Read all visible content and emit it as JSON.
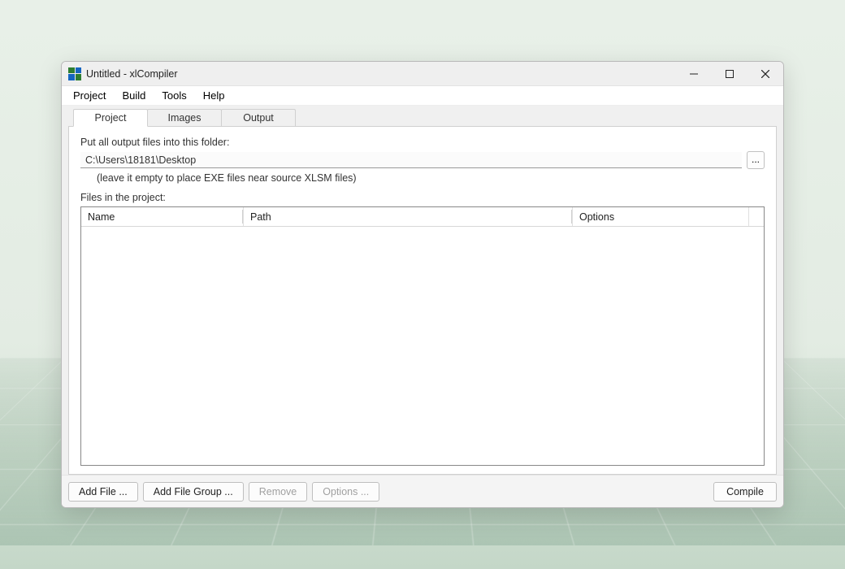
{
  "window": {
    "title": "Untitled - xlCompiler"
  },
  "menubar": {
    "items": [
      "Project",
      "Build",
      "Tools",
      "Help"
    ]
  },
  "tabs": {
    "items": [
      "Project",
      "Images",
      "Output"
    ],
    "active": 0
  },
  "panel": {
    "output_folder_label": "Put all output files into this folder:",
    "output_folder_value": "C:\\Users\\18181\\Desktop",
    "output_folder_hint": "(leave it empty to place EXE files near source XLSM files)",
    "browse_label": "...",
    "files_label": "Files in the project:",
    "columns": {
      "name": "Name",
      "path": "Path",
      "options": "Options"
    }
  },
  "buttons": {
    "add_file": "Add File ...",
    "add_group": "Add File Group ...",
    "remove": "Remove",
    "options": "Options ...",
    "compile": "Compile"
  }
}
